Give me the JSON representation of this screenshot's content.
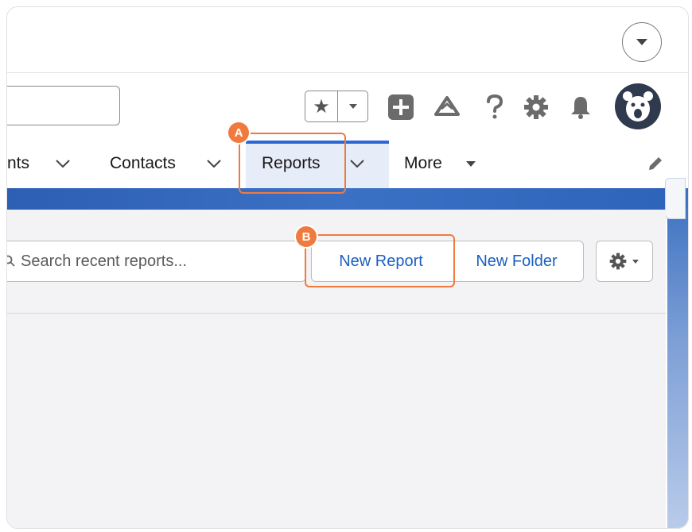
{
  "header": {
    "fav_star": "★"
  },
  "nav": {
    "items": [
      {
        "label": "nts"
      },
      {
        "label": "Contacts"
      },
      {
        "label": "Reports"
      },
      {
        "label": "More"
      }
    ]
  },
  "reports": {
    "search_placeholder": "Search recent reports...",
    "new_report_label": "New Report",
    "new_folder_label": "New Folder"
  },
  "callouts": {
    "a": "A",
    "b": "B"
  },
  "colors": {
    "accent": "#2b68d6",
    "callout": "#f07a3e",
    "link": "#1b5fbf",
    "avatar_bg": "#2f3a4f"
  }
}
